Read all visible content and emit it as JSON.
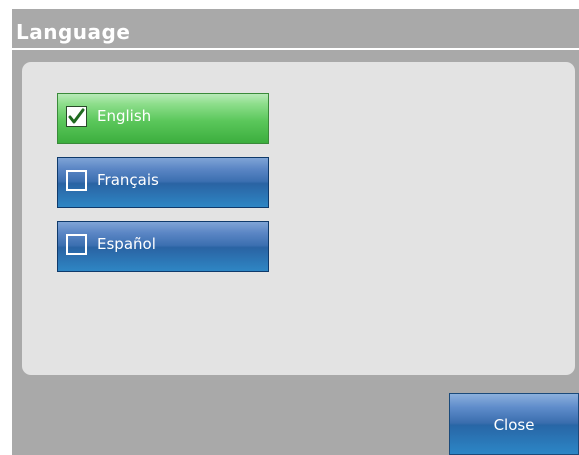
{
  "dialog": {
    "title": "Language",
    "close_label": "Close"
  },
  "languages": [
    {
      "label": "English",
      "checked": true
    },
    {
      "label": "Français",
      "checked": false
    },
    {
      "label": "Español",
      "checked": false
    }
  ],
  "colors": {
    "selected": "#5bc75b",
    "unselected": "#3b6fb0",
    "panel": "#e3e3e3",
    "dialog_bg": "#a9a9a9"
  },
  "icons": {
    "check": "check-icon"
  }
}
